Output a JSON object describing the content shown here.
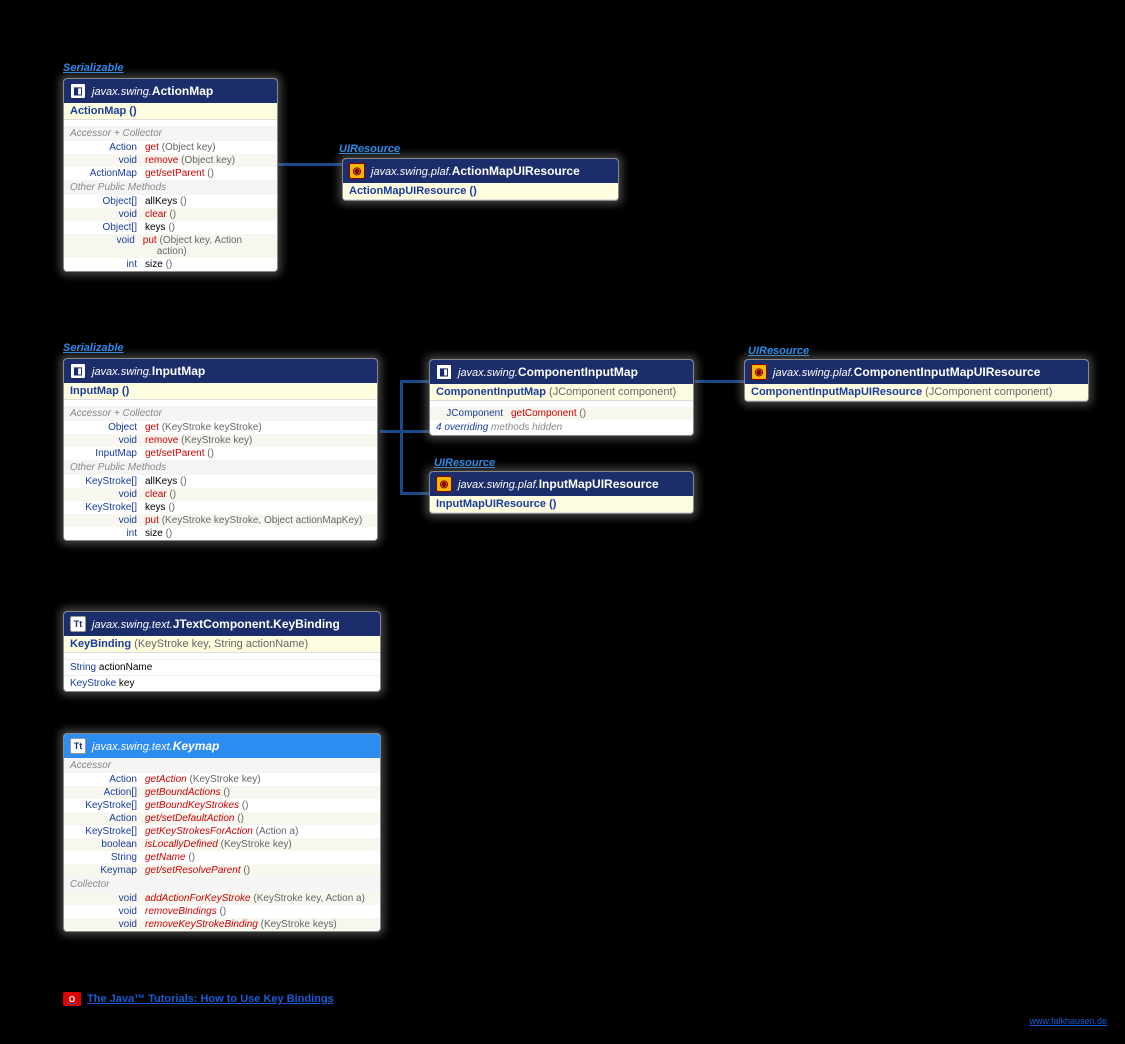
{
  "labels": {
    "serializable": "Serializable",
    "uiresource": "UIResource"
  },
  "boxes": {
    "actionmap": {
      "pkg": "javax.swing.",
      "cls": "ActionMap",
      "ctor": "ActionMap ()",
      "group1": "Accessor + Collector",
      "rows1": [
        {
          "ret": "Action",
          "m": "get",
          "p": "(Object key)"
        },
        {
          "ret": "void",
          "m": "remove",
          "p": "(Object key)"
        },
        {
          "ret": "ActionMap",
          "m": "get/setParent",
          "p": "()"
        }
      ],
      "group2": "Other Public Methods",
      "rows2": [
        {
          "ret": "Object[]",
          "m": "allKeys",
          "p": "()"
        },
        {
          "ret": "void",
          "m": "clear",
          "p": "()"
        },
        {
          "ret": "Object[]",
          "m": "keys",
          "p": "()"
        },
        {
          "ret": "void",
          "m": "put",
          "p": "(Object key, Action action)"
        },
        {
          "ret": "int",
          "m": "size",
          "p": "()"
        }
      ]
    },
    "actionmap_ui": {
      "pkg": "javax.swing.plaf.",
      "cls": "ActionMapUIResource",
      "ctor": "ActionMapUIResource ()"
    },
    "inputmap": {
      "pkg": "javax.swing.",
      "cls": "InputMap",
      "ctor": "InputMap ()",
      "group1": "Accessor + Collector",
      "rows1": [
        {
          "ret": "Object",
          "m": "get",
          "p": "(KeyStroke keyStroke)"
        },
        {
          "ret": "void",
          "m": "remove",
          "p": "(KeyStroke key)"
        },
        {
          "ret": "InputMap",
          "m": "get/setParent",
          "p": "()"
        }
      ],
      "group2": "Other Public Methods",
      "rows2": [
        {
          "ret": "KeyStroke[]",
          "m": "allKeys",
          "p": "()"
        },
        {
          "ret": "void",
          "m": "clear",
          "p": "()"
        },
        {
          "ret": "KeyStroke[]",
          "m": "keys",
          "p": "()"
        },
        {
          "ret": "void",
          "m": "put",
          "p": "(KeyStroke keyStroke, Object actionMapKey)"
        },
        {
          "ret": "int",
          "m": "size",
          "p": "()"
        }
      ]
    },
    "componentinputmap": {
      "pkg": "javax.swing.",
      "cls": "ComponentInputMap",
      "ctor_pre": "ComponentInputMap",
      "ctor_params": " (JComponent component)",
      "rows": [
        {
          "ret": "JComponent",
          "m": "getComponent",
          "p": "()"
        }
      ],
      "hidden": "4 overriding methods hidden"
    },
    "componentinputmap_ui": {
      "pkg": "javax.swing.plaf.",
      "cls": "ComponentInputMapUIResource",
      "ctor_pre": "ComponentInputMapUIResource",
      "ctor_params": " (JComponent component)"
    },
    "inputmap_ui": {
      "pkg": "javax.swing.plaf.",
      "cls": "InputMapUIResource",
      "ctor": "InputMapUIResource ()"
    },
    "keybinding": {
      "pkg": "javax.swing.text.",
      "cls": "JTextComponent.KeyBinding",
      "ctor_pre": "KeyBinding",
      "ctor_params": " (KeyStroke key, String actionName)",
      "fields": [
        {
          "type": "String",
          "name": "actionName"
        },
        {
          "type": "KeyStroke",
          "name": "key"
        }
      ]
    },
    "keymap": {
      "pkg": "javax.swing.text.",
      "cls": "Keymap",
      "group1": "Accessor",
      "rows1": [
        {
          "ret": "Action",
          "m": "getAction",
          "p": "(KeyStroke key)"
        },
        {
          "ret": "Action[]",
          "m": "getBoundActions",
          "p": "()"
        },
        {
          "ret": "KeyStroke[]",
          "m": "getBoundKeyStrokes",
          "p": "()"
        },
        {
          "ret": "Action",
          "m": "get/setDefaultAction",
          "p": "()"
        },
        {
          "ret": "KeyStroke[]",
          "m": "getKeyStrokesForAction",
          "p": "(Action a)"
        },
        {
          "ret": "boolean",
          "m": "isLocallyDefined",
          "p": "(KeyStroke key)"
        },
        {
          "ret": "String",
          "m": "getName",
          "p": "()"
        },
        {
          "ret": "Keymap",
          "m": "get/setResolveParent",
          "p": "()"
        }
      ],
      "group2": "Collector",
      "rows2": [
        {
          "ret": "void",
          "m": "addActionForKeyStroke",
          "p": "(KeyStroke key, Action a)"
        },
        {
          "ret": "void",
          "m": "removeBindings",
          "p": "()"
        },
        {
          "ret": "void",
          "m": "removeKeyStrokeBinding",
          "p": "(KeyStroke keys)"
        }
      ]
    }
  },
  "footer": {
    "link": "The Java™ Tutorials: How to Use Key Bindings",
    "site": "www.falkhausen.de"
  }
}
